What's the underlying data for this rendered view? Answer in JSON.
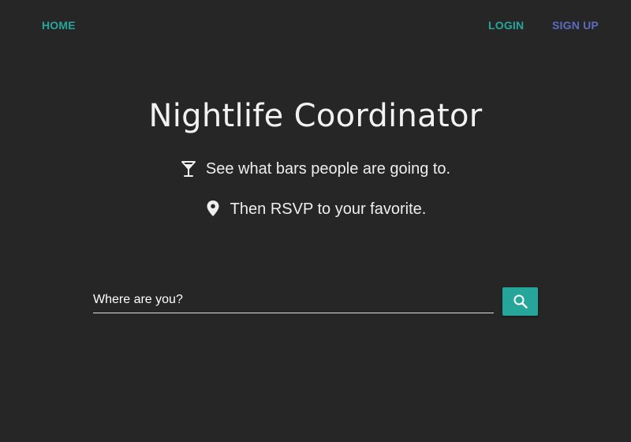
{
  "nav": {
    "home_label": "HOME",
    "login_label": "LOGIN",
    "signup_label": "SIGN UP"
  },
  "hero": {
    "title": "Nightlife Coordinator",
    "features": [
      {
        "icon": "martini-glass-icon",
        "text": "See what bars people are going to."
      },
      {
        "icon": "map-marker-icon",
        "text": "Then RSVP to your favorite."
      }
    ]
  },
  "search": {
    "placeholder": "Where are you?",
    "value": "",
    "button_icon": "search-icon"
  },
  "colors": {
    "background": "#262626",
    "accent_teal": "#26a69a",
    "accent_indigo": "#5c6bc0",
    "text": "#eeeeee"
  }
}
